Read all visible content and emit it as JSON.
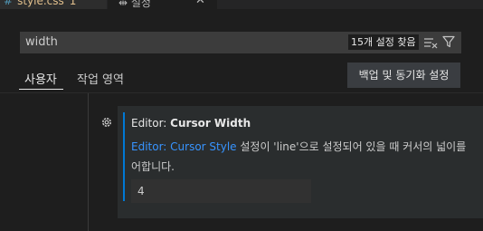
{
  "tabs": [
    {
      "hash": "#",
      "label": "style.css",
      "problems": "1"
    },
    {
      "icon": "settings-icon",
      "label": "설정"
    }
  ],
  "search": {
    "value": "width",
    "result_count": "15개 설정 찾음"
  },
  "scopes": {
    "user": "사용자",
    "workspace": "작업 영역"
  },
  "sync_button": "백업 및 동기화 설정",
  "setting": {
    "category": "Editor: ",
    "name": "Cursor Width",
    "description_link": "Editor: Cursor Style",
    "description_rest": " 설정이 'line'으로 설정되어 있을 때 커서의 넓이를",
    "description_line2": "어합니다.",
    "value": "4"
  },
  "colors": {
    "accent": "#0078d4",
    "link": "#3794ff",
    "modified_tab": "#e2c08d"
  }
}
